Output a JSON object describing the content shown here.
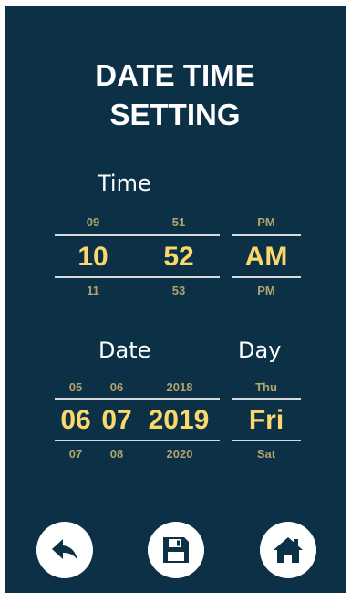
{
  "title": {
    "line1": "DATE TIME",
    "line2": "SETTING"
  },
  "time": {
    "label": "Time",
    "hour": {
      "prev": "09",
      "current": "10",
      "next": "11"
    },
    "minute": {
      "prev": "51",
      "current": "52",
      "next": "53"
    },
    "ampm": {
      "prev": "PM",
      "current": "AM",
      "next": "PM"
    }
  },
  "date": {
    "label": "Date",
    "day": {
      "prev": "05",
      "current": "06",
      "next": "07"
    },
    "month": {
      "prev": "06",
      "current": "07",
      "next": "08"
    },
    "year": {
      "prev": "2018",
      "current": "2019",
      "next": "2020"
    }
  },
  "weekday": {
    "label": "Day",
    "prev": "Thu",
    "current": "Fri",
    "next": "Sat"
  },
  "buttons": {
    "back_icon": "back-arrow-icon",
    "save_icon": "floppy-disk-icon",
    "home_icon": "home-icon"
  },
  "colors": {
    "background": "#0c3147",
    "selected_value": "#fbd86b",
    "adjacent_value": "#b1a36e",
    "text": "#ffffff"
  }
}
